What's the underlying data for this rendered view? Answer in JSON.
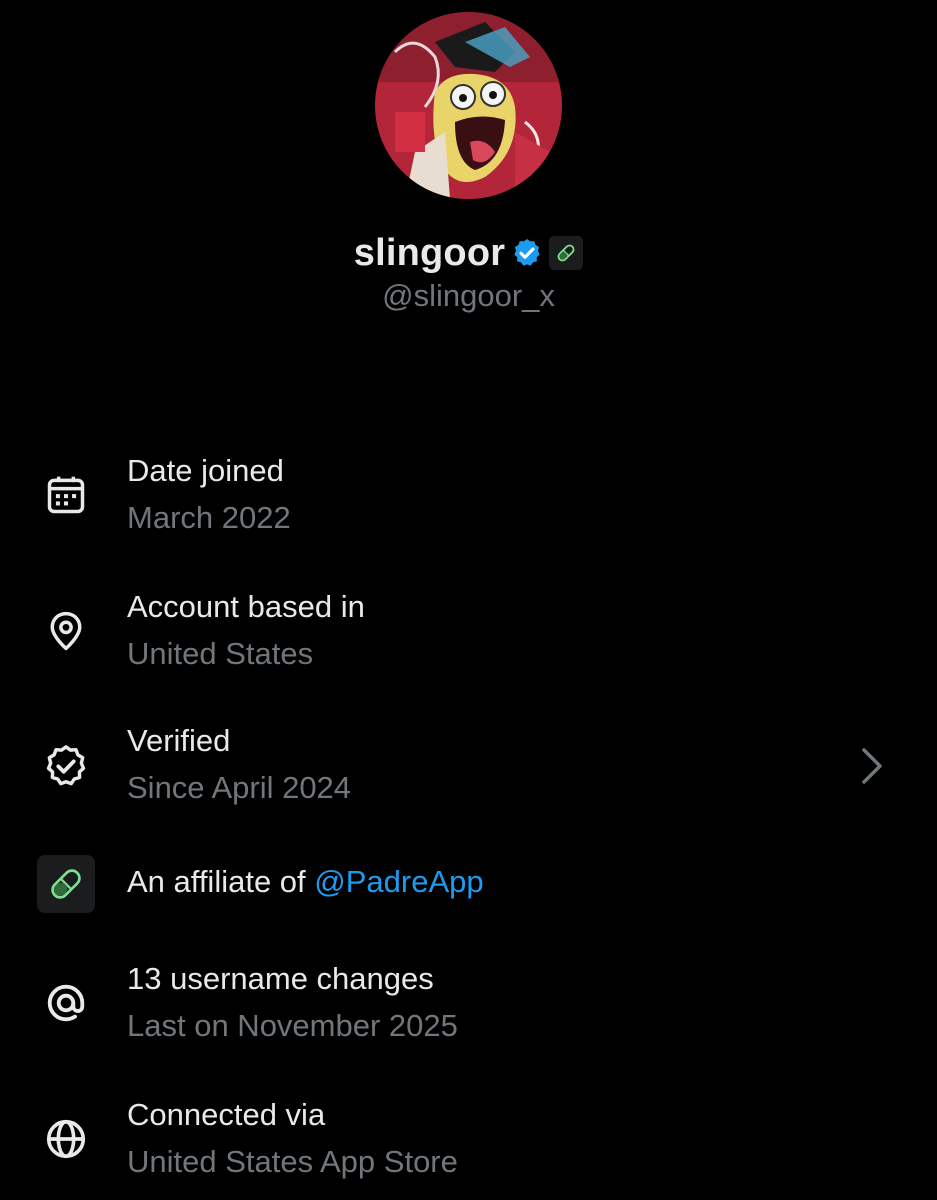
{
  "profile": {
    "display_name": "slingoor",
    "handle": "@slingoor_x",
    "verified_badge_color": "#1d9bf0",
    "affiliate_badge_icon": "pill-icon"
  },
  "details": {
    "date_joined": {
      "icon": "calendar-icon",
      "title": "Date joined",
      "value": "March 2022"
    },
    "based_in": {
      "icon": "location-pin-icon",
      "title": "Account based in",
      "value": "United States"
    },
    "verified": {
      "icon": "verified-badge-icon",
      "title": "Verified",
      "value": "Since April 2024"
    },
    "affiliate": {
      "icon": "pill-icon",
      "prefix": "An affiliate of ",
      "link": "@PadreApp"
    },
    "username_changes": {
      "icon": "at-sign-icon",
      "title": "13 username changes",
      "value": "Last on November 2025"
    },
    "connected_via": {
      "icon": "globe-icon",
      "title": "Connected via",
      "value": "United States App Store"
    }
  },
  "colors": {
    "background": "#000000",
    "primary_text": "#e7e9ea",
    "secondary_text": "#71767b",
    "link": "#1d9bf0",
    "affiliate_green": "#7ee08f"
  }
}
